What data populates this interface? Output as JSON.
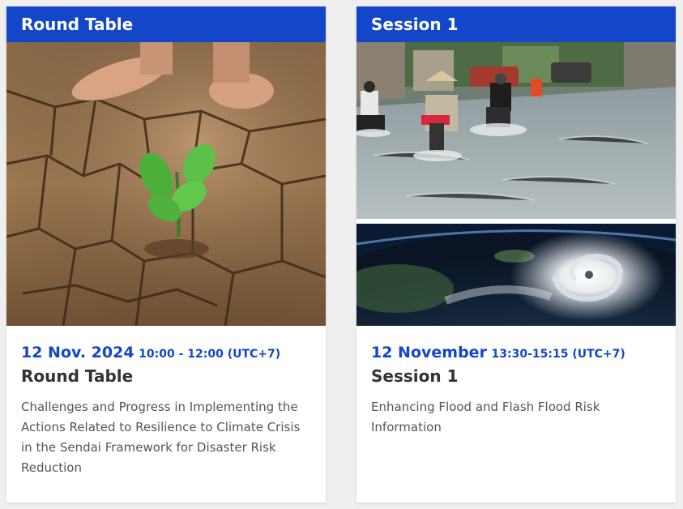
{
  "cards": [
    {
      "header": "Round Table",
      "date": "12 Nov. 2024",
      "time": "10:00 - 12:00 (UTC+7)",
      "title": "Round Table",
      "description": "Challenges and Progress in Implementing the Actions Related to Resilience to Climate Crisis in the Sendai Framework for Disaster Risk Reduction",
      "image": "drought-cracked-earth-seedling-image"
    },
    {
      "header": "Session 1",
      "date": "12 November",
      "time": "13:30-15:15 (UTC+7)",
      "title": "Session 1",
      "description": "Enhancing Flood and Flash Flood Risk Information",
      "images": [
        "flooded-street-motorbikes-image",
        "typhoon-from-space-image"
      ]
    }
  ],
  "colors": {
    "accent": "#1346c8",
    "title": "#333333",
    "body_text": "#555555",
    "background": "#efefef"
  }
}
